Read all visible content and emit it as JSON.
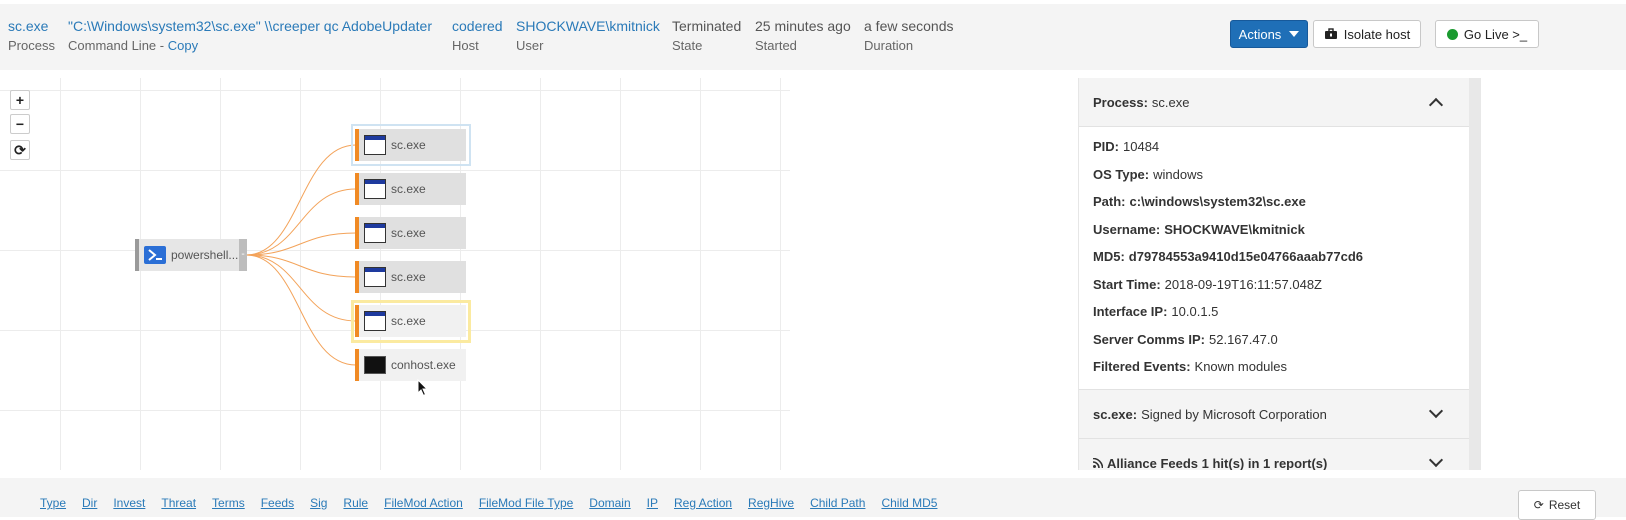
{
  "header": {
    "process": {
      "value": "sc.exe",
      "label": "Process"
    },
    "command_line": {
      "value": "\"C:\\Windows\\system32\\sc.exe\" \\\\creeper qc AdobeUpdater",
      "label": "Command Line - ",
      "copy": "Copy"
    },
    "host": {
      "value": "codered",
      "label": "Host"
    },
    "user": {
      "value": "SHOCKWAVE\\kmitnick",
      "label": "User"
    },
    "state": {
      "value": "Terminated",
      "label": "State"
    },
    "started": {
      "value": "25 minutes ago",
      "label": "Started"
    },
    "duration": {
      "value": "a few seconds",
      "label": "Duration"
    },
    "actions_label": "Actions",
    "isolate_label": "Isolate host",
    "golive_label": "Go Live >_"
  },
  "graph": {
    "zoom_in": "+",
    "zoom_out": "−",
    "reset": "⟳",
    "parent": "powershell....",
    "collapse": "-",
    "children": [
      "sc.exe",
      "sc.exe",
      "sc.exe",
      "sc.exe",
      "sc.exe",
      "conhost.exe"
    ]
  },
  "panel": {
    "title_key": "Process:",
    "title_value": "sc.exe",
    "fields": [
      {
        "k": "PID:",
        "v": "10484"
      },
      {
        "k": "OS Type:",
        "v": "windows"
      },
      {
        "k": "Path:",
        "v": "c:\\windows\\system32\\sc.exe"
      },
      {
        "k": "Username:",
        "v": "SHOCKWAVE\\kmitnick"
      },
      {
        "k": "MD5:",
        "v": "d79784553a9410d15e04766aaab77cd6"
      },
      {
        "k": "Start Time:",
        "v": "2018-09-19T16:11:57.048Z"
      },
      {
        "k": "Interface IP:",
        "v": "10.0.1.5"
      },
      {
        "k": "Server Comms IP:",
        "v": "52.167.47.0"
      },
      {
        "k": "Filtered Events:",
        "v": "Known modules"
      }
    ],
    "signed_key": "sc.exe:",
    "signed_value": "Signed by Microsoft Corporation",
    "alliance": "Alliance Feeds 1 hit(s) in 1 report(s)"
  },
  "bottom": {
    "tabs": [
      "Type",
      "Dir",
      "Invest",
      "Threat",
      "Terms",
      "Feeds",
      "Sig",
      "Rule",
      "FileMod Action",
      "FileMod File Type",
      "Domain",
      "IP",
      "Reg Action",
      "RegHive",
      "Child Path",
      "Child MD5"
    ],
    "reset_label": "Reset"
  }
}
